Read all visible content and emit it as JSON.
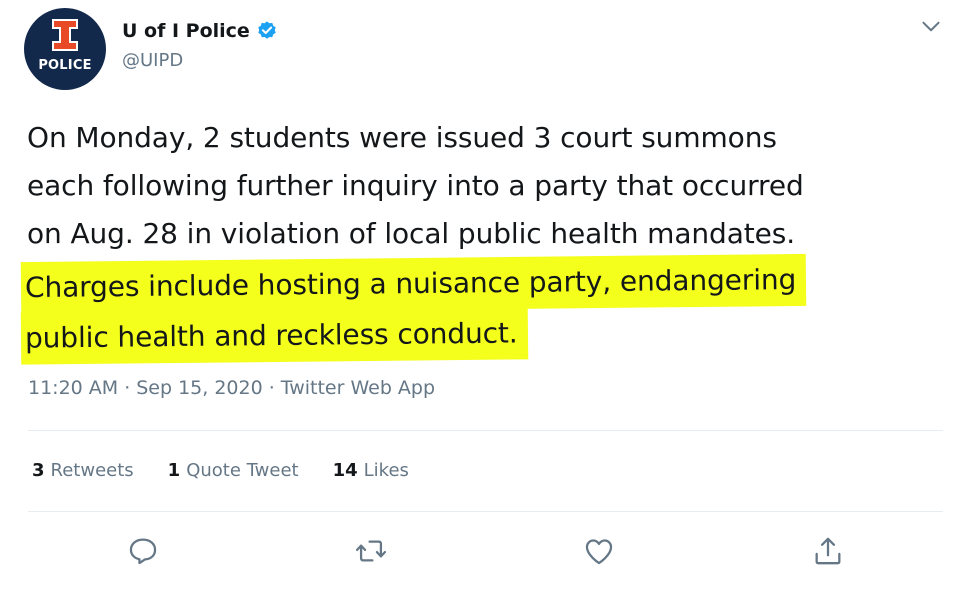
{
  "account": {
    "display_name": "U of I Police",
    "handle": "@UIPD",
    "avatar_letter": "I",
    "avatar_label": "POLICE",
    "verified": true
  },
  "tweet": {
    "lines": [
      "On Monday, 2 students were issued 3 court summons",
      "each following further inquiry into a party that occurred",
      "on Aug. 28 in violation of local public health mandates."
    ],
    "highlighted_lines": [
      "Charges include hosting a nuisance party, endangering",
      "public health and reckless conduct."
    ]
  },
  "meta": {
    "time": "11:20 AM",
    "separator": "·",
    "date": "Sep 15, 2020",
    "source": "Twitter Web App"
  },
  "stats": {
    "retweets_count": "3",
    "retweets_label": "Retweets",
    "quotes_count": "1",
    "quotes_label": "Quote Tweet",
    "likes_count": "14",
    "likes_label": "Likes"
  },
  "colors": {
    "avatar_bg": "#13294b",
    "avatar_accent": "#e84a27",
    "verified": "#1da1f2",
    "muted_text": "#657786",
    "highlight": "#f4ff1c"
  },
  "icons": [
    "verified-icon",
    "caret-down-icon",
    "reply-icon",
    "retweet-icon",
    "like-icon",
    "share-icon"
  ]
}
